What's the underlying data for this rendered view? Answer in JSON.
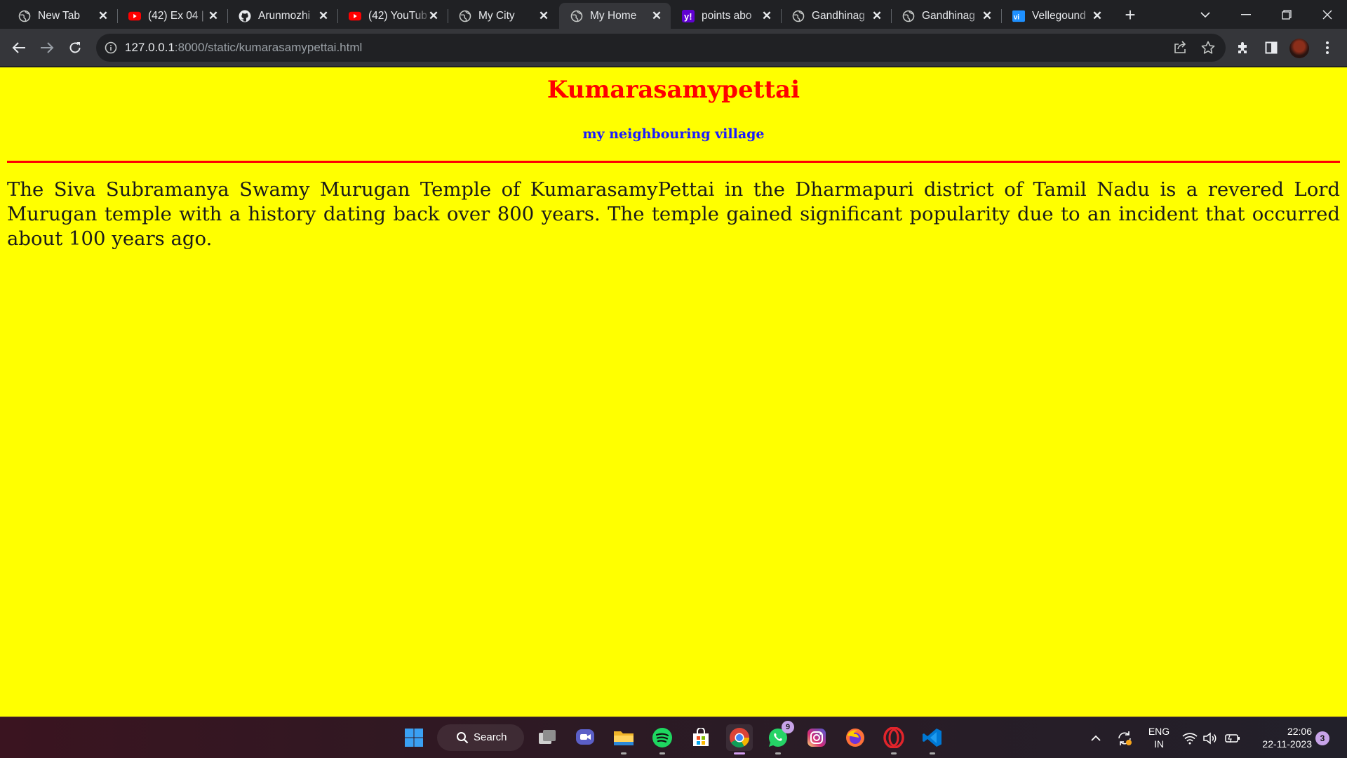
{
  "browser": {
    "tabs": [
      {
        "title": "New Tab",
        "favicon": "globe-icon",
        "active": false
      },
      {
        "title": "(42) Ex 04 |",
        "favicon": "youtube-icon",
        "active": false
      },
      {
        "title": "Arunmozhi",
        "favicon": "github-icon",
        "active": false
      },
      {
        "title": "(42) YouTub",
        "favicon": "youtube-icon",
        "active": false
      },
      {
        "title": "My City",
        "favicon": "globe-icon",
        "active": false
      },
      {
        "title": "My Home",
        "favicon": "globe-icon",
        "active": true
      },
      {
        "title": "points abo",
        "favicon": "yahoo-icon",
        "active": false
      },
      {
        "title": "Gandhinag",
        "favicon": "globe-icon",
        "active": false
      },
      {
        "title": "Gandhinag",
        "favicon": "globe-icon",
        "active": false
      },
      {
        "title": "Vellegound",
        "favicon": "vellegoundanpalayam-icon",
        "active": false
      }
    ],
    "address": {
      "host": "127.0.0.1",
      "path": ":8000/static/kumarasamypettai.html"
    },
    "accent": "#35363a"
  },
  "page": {
    "heading": "Kumarasamypettai",
    "subheading": "my neighbouring village",
    "paragraph": "The Siva Subramanya Swamy Murugan Temple of KumarasamyPettai in the Dharmapuri district of Tamil Nadu is a revered Lord Murugan temple with a history dating back over 800 years. The temple gained significant popularity due to an incident that occurred about 100 years ago.",
    "colors": {
      "background": "#ffff00",
      "heading": "#ff0000",
      "subheading": "#1a1aff",
      "rule": "#ff0000"
    }
  },
  "taskbar": {
    "search_label": "Search",
    "whatsapp_badge": "9",
    "language_top": "ENG",
    "language_bottom": "IN",
    "time": "22:06",
    "date": "22-11-2023",
    "notification_count": "3"
  }
}
